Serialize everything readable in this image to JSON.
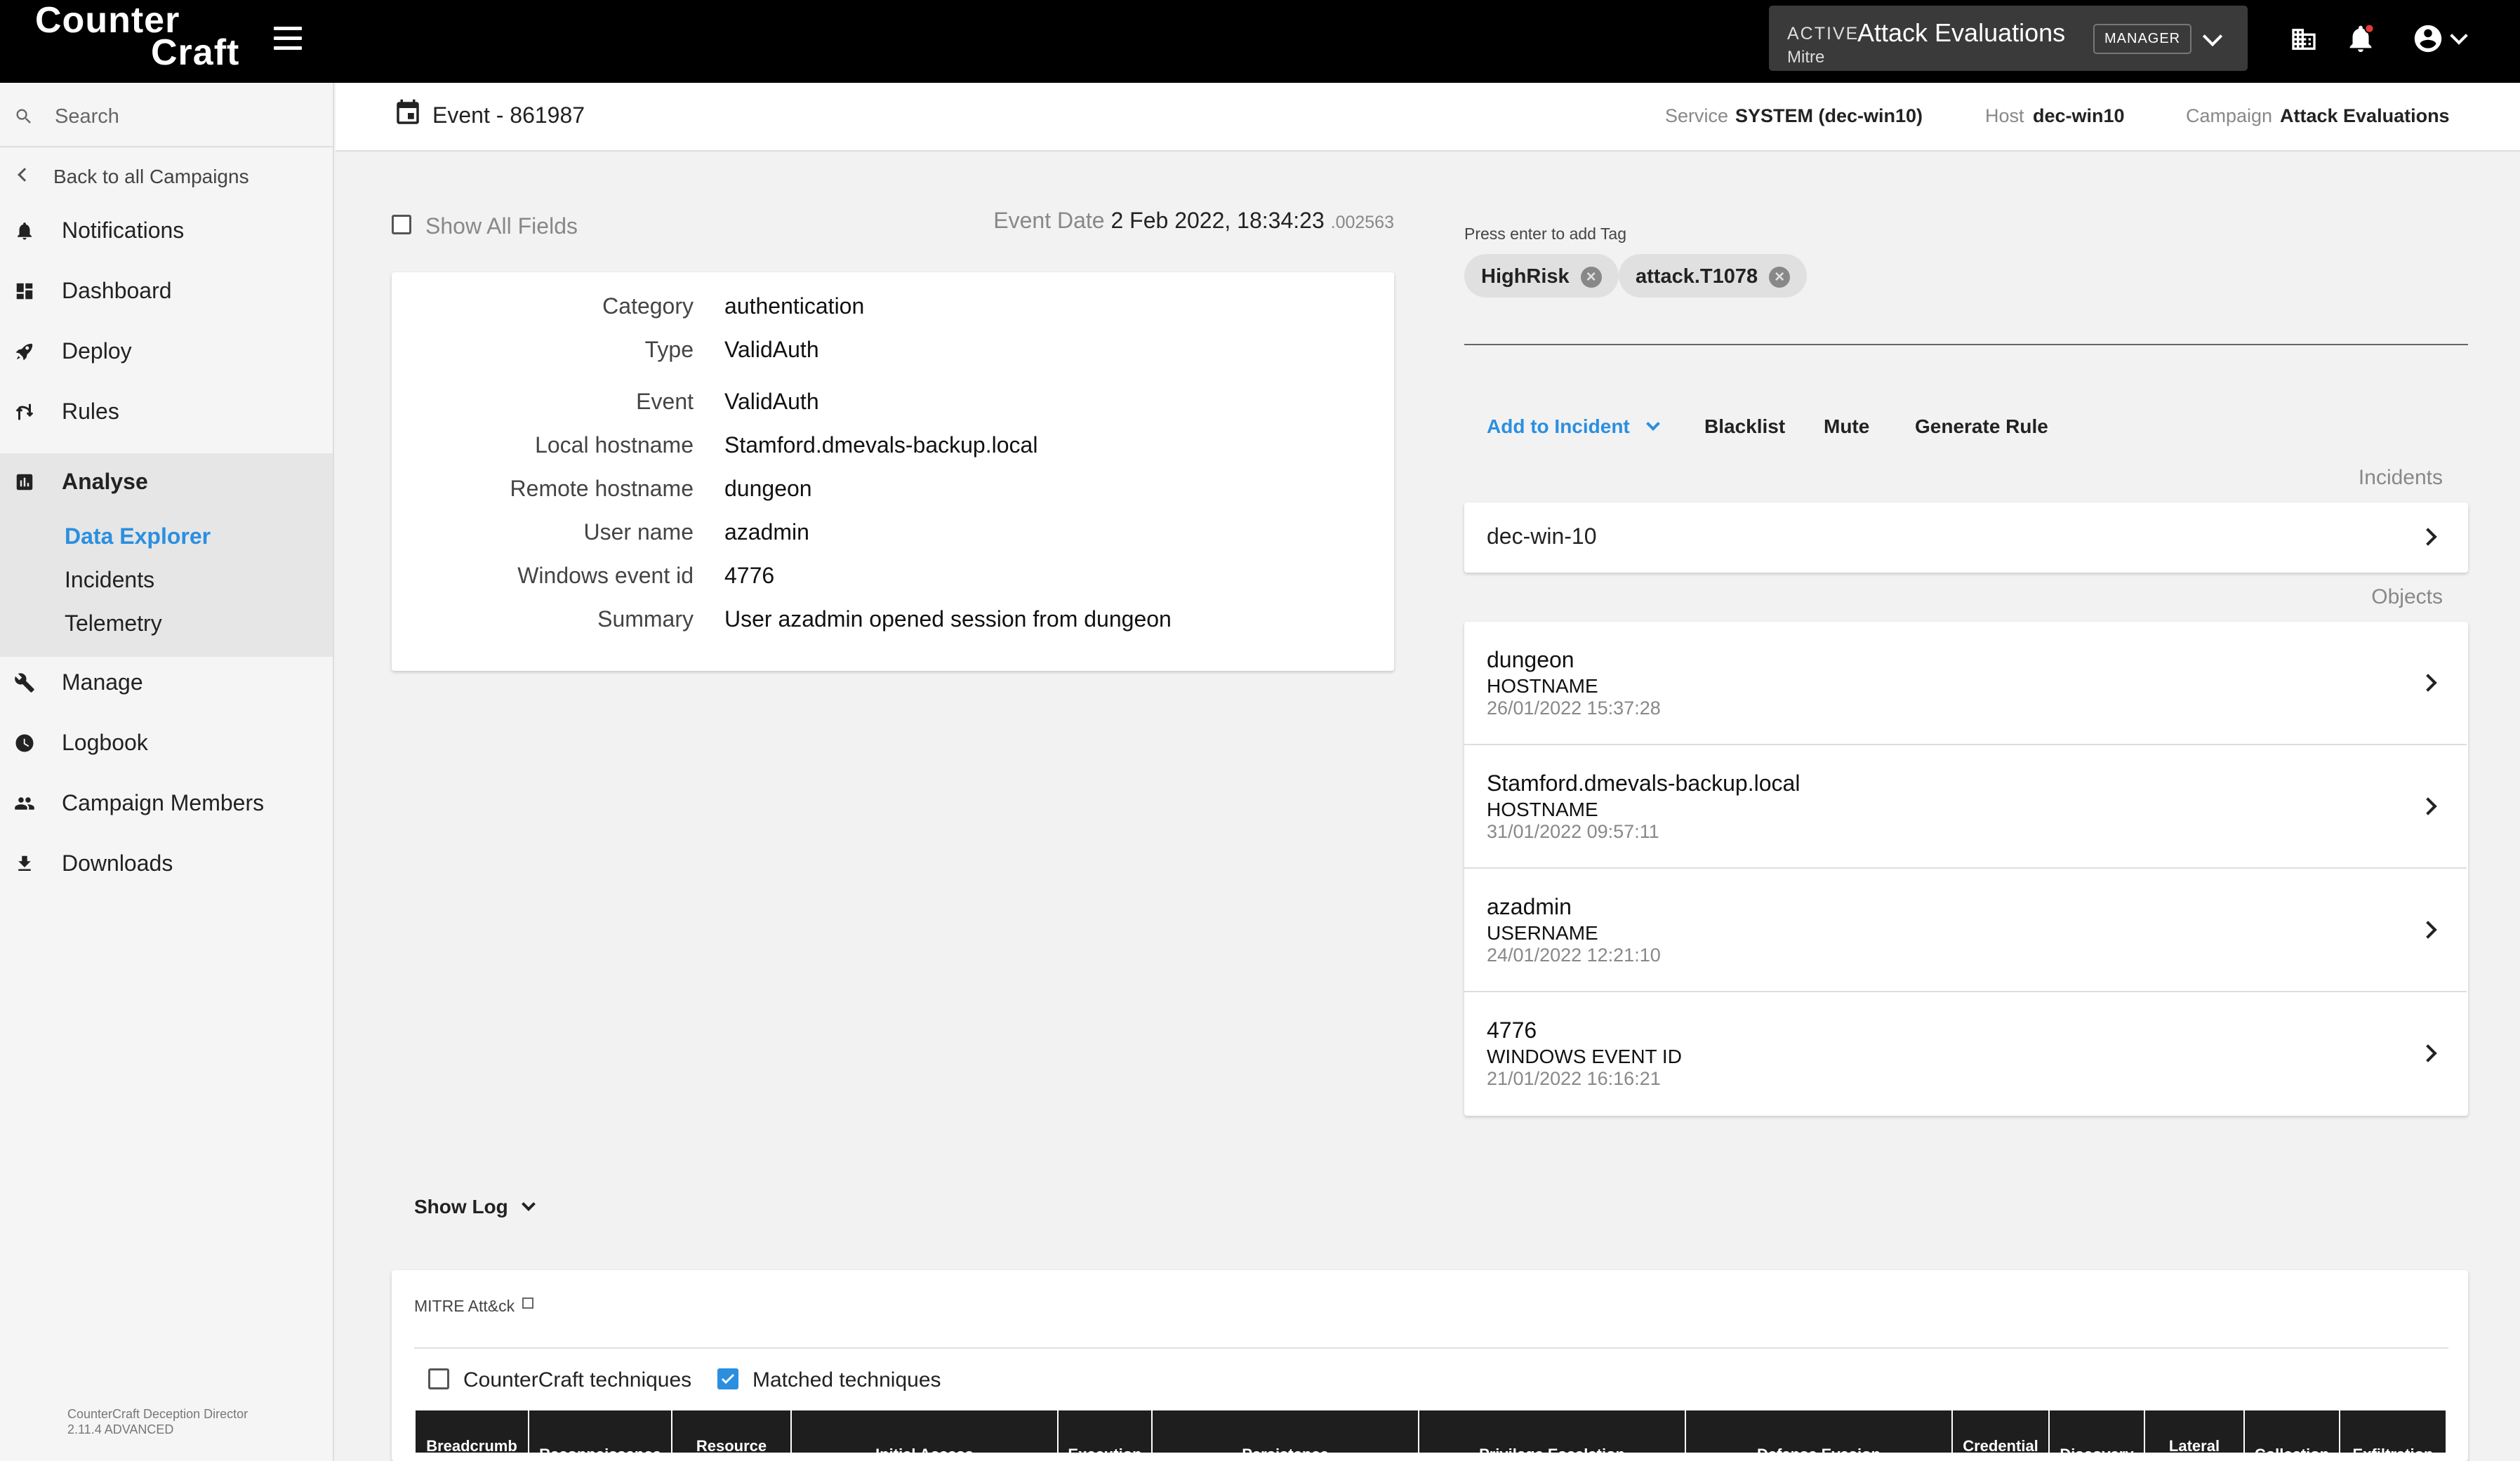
{
  "topbar": {
    "logo_line1": "Counter",
    "logo_line2": "Craft",
    "campaign_status": "ACTIVE",
    "campaign_name": "Attack Evaluations",
    "campaign_org": "Mitre",
    "role_badge": "MANAGER"
  },
  "sidebar": {
    "search_placeholder": "Search",
    "back_label": "Back to all Campaigns",
    "items": [
      {
        "label": "Notifications",
        "icon": "bell-icon"
      },
      {
        "label": "Dashboard",
        "icon": "dashboard-icon"
      },
      {
        "label": "Deploy",
        "icon": "rocket-icon"
      },
      {
        "label": "Rules",
        "icon": "rules-icon"
      },
      {
        "label": "Analyse",
        "icon": "chart-icon"
      },
      {
        "label": "Manage",
        "icon": "wrench-icon"
      },
      {
        "label": "Logbook",
        "icon": "clock-icon"
      },
      {
        "label": "Campaign Members",
        "icon": "people-icon"
      },
      {
        "label": "Downloads",
        "icon": "download-icon"
      }
    ],
    "analyse_sub": [
      "Data Explorer",
      "Incidents",
      "Telemetry"
    ],
    "version_line1": "CounterCraft Deception Director",
    "version_line2": "2.11.4 ADVANCED"
  },
  "header": {
    "event_title": "Event - 861987",
    "service_label": "Service",
    "service_value": "SYSTEM (dec-win10)",
    "host_label": "Host",
    "host_value": "dec-win10",
    "campaign_label": "Campaign",
    "campaign_value": "Attack Evaluations"
  },
  "event": {
    "show_all_fields": "Show All Fields",
    "date_label": "Event Date",
    "date_value": "2 Feb 2022, 18:34:23",
    "date_fraction": ".002563",
    "fields": [
      {
        "key": "Category",
        "value": "authentication"
      },
      {
        "key": "Type",
        "value": "ValidAuth"
      },
      {
        "key": "Event",
        "value": "ValidAuth"
      },
      {
        "key": "Local hostname",
        "value": "Stamford.dmevals-backup.local"
      },
      {
        "key": "Remote hostname",
        "value": "dungeon"
      },
      {
        "key": "User name",
        "value": "azadmin"
      },
      {
        "key": "Windows event id",
        "value": "4776"
      },
      {
        "key": "Summary",
        "value": "User azadmin opened session from dungeon"
      }
    ]
  },
  "tags": {
    "hint": "Press enter to add Tag",
    "items": [
      "HighRisk",
      "attack.T1078"
    ]
  },
  "actions": {
    "add_to_incident": "Add to Incident",
    "blacklist": "Blacklist",
    "mute": "Mute",
    "generate_rule": "Generate Rule"
  },
  "incidents": {
    "heading": "Incidents",
    "items": [
      "dec-win-10"
    ]
  },
  "objects": {
    "heading": "Objects",
    "items": [
      {
        "name": "dungeon",
        "type": "HOSTNAME",
        "date": "26/01/2022 15:37:28"
      },
      {
        "name": "Stamford.dmevals-backup.local",
        "type": "HOSTNAME",
        "date": "31/01/2022 09:57:11"
      },
      {
        "name": "azadmin",
        "type": "USERNAME",
        "date": "24/01/2022 12:21:10"
      },
      {
        "name": "4776",
        "type": "WINDOWS EVENT ID",
        "date": "21/01/2022 16:16:21"
      }
    ]
  },
  "show_log": "Show Log",
  "mitre": {
    "title": "MITRE Att&ck",
    "cc_techniques": "CounterCraft techniques",
    "matched_techniques": "Matched techniques",
    "matched_checked": true,
    "columns": [
      "Breadcrumb",
      "Reconnaissance",
      "Resource",
      "Initial Access",
      "Execution",
      "Persistence",
      "Privilege Escalation",
      "Defense Evasion",
      "Credential",
      "Discovery",
      "Lateral",
      "Collection",
      "Exfiltration"
    ]
  },
  "colors": {
    "accent": "#2b8fe0",
    "topbar": "#000000",
    "sidebar_active": "#e6e6e6"
  }
}
